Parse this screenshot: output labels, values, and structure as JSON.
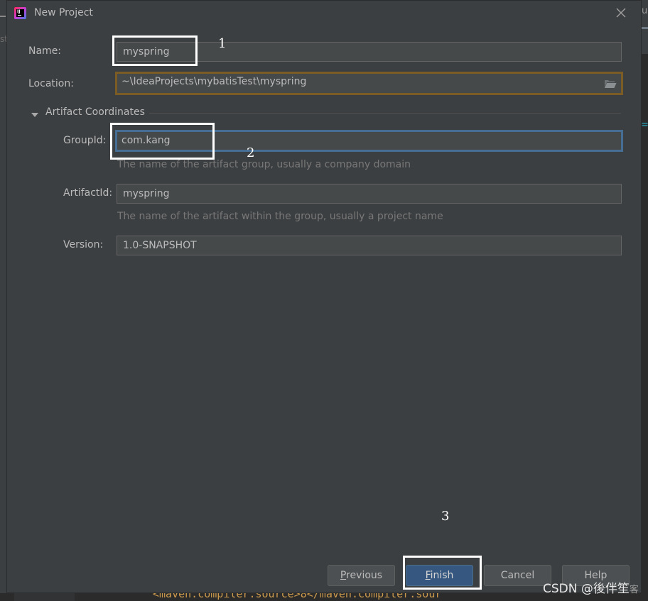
{
  "background": {
    "left_text": "st",
    "right_tab_text": "u",
    "right_code_text": "=p",
    "bottom_code_text": "<maven.compiler.source>8</maven.compiler.sour"
  },
  "dialog": {
    "title": "New Project",
    "icon": "intellij-idea-icon",
    "fields": {
      "name": {
        "label": "Name:",
        "value": "myspring"
      },
      "location": {
        "label": "Location:",
        "value": "~\\IdeaProjects\\mybatisTest\\myspring",
        "icon": "folder-open-icon"
      }
    },
    "section": {
      "title": "Artifact Coordinates",
      "expanded": true,
      "group_id": {
        "label": "GroupId:",
        "value": "com.kang",
        "hint": "The name of the artifact group, usually a company domain"
      },
      "artifact_id": {
        "label": "ArtifactId:",
        "value": "myspring",
        "hint": "The name of the artifact within the group, usually a project name"
      },
      "version": {
        "label": "Version:",
        "value": "1.0-SNAPSHOT"
      }
    },
    "buttons": {
      "previous": {
        "mnemonic": "P",
        "rest": "revious"
      },
      "finish": {
        "mnemonic": "F",
        "rest": "inish"
      },
      "cancel": "Cancel",
      "help": "Help"
    }
  },
  "annotations": {
    "step1": "1",
    "step2": "2",
    "step3": "3",
    "watermark": "CSDN @後伴笙",
    "watermark_suffix": "客"
  },
  "colors": {
    "dialog_bg": "#3c3f41",
    "field_bg": "#45494a",
    "focus_border": "#466d94",
    "warning_border": "#7a5c24",
    "primary_button": "#365880"
  }
}
